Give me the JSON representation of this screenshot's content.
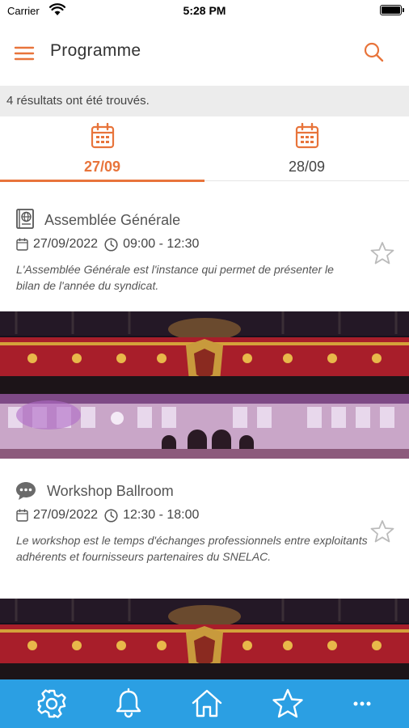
{
  "status_bar": {
    "carrier": "Carrier",
    "time": "5:28 PM"
  },
  "header": {
    "title": "Programme"
  },
  "results": {
    "text": "4 résultats ont été trouvés."
  },
  "date_tabs": [
    {
      "label": "27/09",
      "active": true
    },
    {
      "label": "28/09",
      "active": false
    }
  ],
  "events": [
    {
      "type_icon": "globe-book-icon",
      "title": "Assemblée Générale",
      "date": "27/09/2022",
      "time": "09:00 - 12:30",
      "description": "L'Assemblée Générale est l'instance qui permet de présenter le bilan de l'année du syndicat."
    },
    {
      "type_icon": "chat-bubble-icon",
      "title": "Workshop Ballroom",
      "date": "27/09/2022",
      "time": "12:30 - 18:00",
      "description": "Le workshop est le temps d'échanges professionnels entre exploitants adhérents et fournisseurs partenaires du SNELAC."
    }
  ],
  "bottom_nav": [
    "gear-icon",
    "bell-icon",
    "home-icon",
    "star-icon",
    "more-icon"
  ],
  "colors": {
    "accent": "#e8743b",
    "tab_bar": "#2b9fe3",
    "results_bg": "#ececec"
  }
}
